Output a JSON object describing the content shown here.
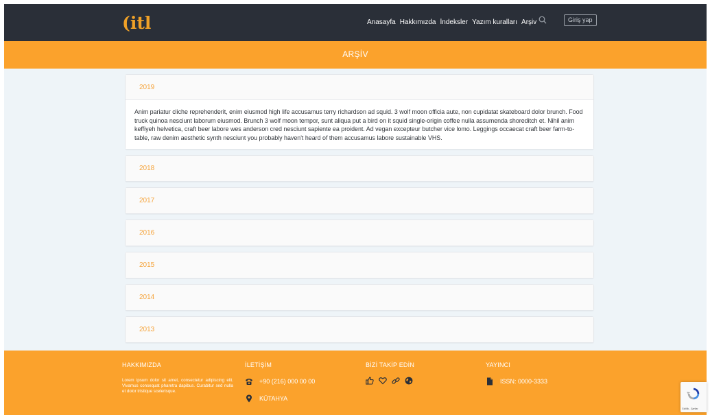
{
  "brand": {
    "logo_text": "(itl"
  },
  "nav": {
    "items": [
      "Anasayfa",
      "Hakkımızda",
      "İndeksler",
      "Yazım kuralları",
      "Arşiv"
    ],
    "search_icon": "search-icon",
    "login_label": "Giriş yap"
  },
  "page": {
    "title": "ARŞİV"
  },
  "archive": {
    "years": [
      "2019",
      "2018",
      "2017",
      "2016",
      "2015",
      "2014",
      "2013"
    ],
    "open_index": 0,
    "open_text": "Anim pariatur cliche reprehenderit, enim eiusmod high life accusamus terry richardson ad squid. 3 wolf moon officia aute, non cupidatat skateboard dolor brunch. Food truck quinoa nesciunt laborum eiusmod. Brunch 3 wolf moon tempor, sunt aliqua put a bird on it squid single-origin coffee nulla assumenda shoreditch et. Nihil anim keffiyeh helvetica, craft beer labore wes anderson cred nesciunt sapiente ea proident. Ad vegan excepteur butcher vice lomo. Leggings occaecat craft beer farm-to-table, raw denim aesthetic synth nesciunt you probably haven't heard of them accusamus labore sustainable VHS."
  },
  "footer": {
    "about": {
      "heading": "HAKKIMIZDA",
      "text": "Lorem ipsum dolor sit amet, consectetur adipiscing elit. Vivamus consequat pharetra dapibus. Curabitur sed nulla et dolor tristique scelerisque."
    },
    "contact": {
      "heading": "İLETİŞİM",
      "phone": "+90 (216) 000 00 00",
      "city": "KÜTAHYA"
    },
    "follow": {
      "heading": "BİZİ TAKİP EDİN",
      "icons": [
        "like-icon",
        "heart-icon",
        "link-icon",
        "globe-icon"
      ]
    },
    "publisher": {
      "heading": "YAYINCI",
      "issn": "ISSN: 0000-3333"
    }
  },
  "recaptcha": {
    "text": "Gizlilik - Şartlar"
  },
  "colors": {
    "navbar": "#2a2f38",
    "accent": "#fba22c",
    "year_text": "#f5a33a",
    "page_bg": "#eef4f8"
  }
}
